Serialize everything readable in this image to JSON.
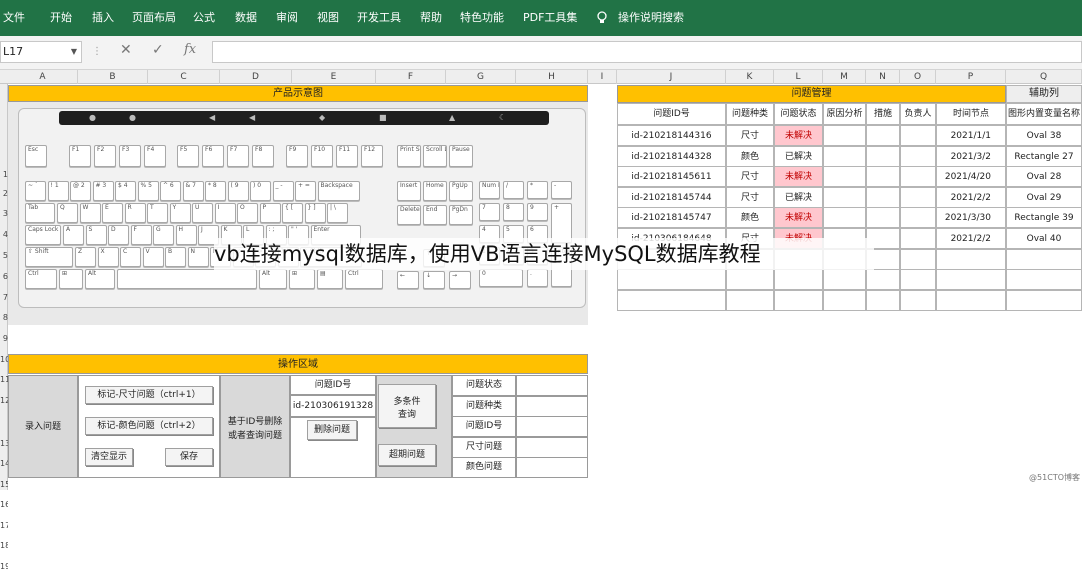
{
  "ribbon": {
    "menu": [
      "文件",
      "开始",
      "插入",
      "页面布局",
      "公式",
      "数据",
      "审阅",
      "视图",
      "开发工具",
      "帮助",
      "特色功能",
      "PDF工具集"
    ],
    "search_label": "操作说明搜索",
    "color": "#217346"
  },
  "formula_bar": {
    "name_box": "L17",
    "cancel_icon": "✕",
    "enter_icon": "✓",
    "function_icon": "fx",
    "value": ""
  },
  "columns": [
    "A",
    "B",
    "C",
    "D",
    "E",
    "F",
    "G",
    "H",
    "I",
    "J",
    "K",
    "L",
    "M",
    "N",
    "O",
    "P",
    "Q"
  ],
  "rows": [
    "1",
    "2",
    "3",
    "4",
    "5",
    "6",
    "7",
    "8",
    "9",
    "10",
    "11",
    "12",
    "13",
    "14",
    "15",
    "16",
    "17",
    "18",
    "19"
  ],
  "product_panel": {
    "title": "产品示意图"
  },
  "keyboard": {
    "fkeys": [
      "Esc",
      "F1",
      "F2",
      "F3",
      "F4",
      "F5",
      "F6",
      "F7",
      "F8",
      "F9",
      "F10",
      "F11",
      "F12"
    ],
    "nav_top": [
      "Print Screen SysRq",
      "Scroll Lock",
      "Pause Break"
    ],
    "nav_mid": [
      "Insert",
      "Home",
      "PgUp",
      "Delete",
      "End",
      "PgDn"
    ],
    "num_row": [
      "~ `",
      "! 1",
      "@ 2",
      "# 3",
      "$ 4",
      "% 5",
      "^ 6",
      "& 7",
      "* 8",
      "( 9",
      ") 0",
      "_ -",
      "+ =",
      "Backspace"
    ],
    "tab_row": [
      "Tab",
      "Q",
      "W",
      "E",
      "R",
      "T",
      "Y",
      "U",
      "I",
      "O",
      "P",
      "{ [",
      "} ]",
      "| \\"
    ],
    "caps_row": [
      "Caps Lock",
      "A",
      "S",
      "D",
      "F",
      "G",
      "H",
      "J",
      "K",
      "L",
      ": ;",
      "\" '",
      "Enter"
    ],
    "shift_row": [
      "⇧ Shift",
      "Z",
      "X",
      "C",
      "V",
      "B",
      "N",
      "M",
      "< ,",
      "> .",
      "? /",
      "⇧ Shift"
    ],
    "ctrl_row": [
      "Ctrl",
      "⊞",
      "Alt",
      "",
      "Alt",
      "⊞",
      "▤",
      "Ctrl"
    ],
    "arrows": [
      "↑",
      "←",
      "↓",
      "→"
    ],
    "numpad": [
      "Num Lock",
      "/",
      "*",
      "-",
      "7",
      "8",
      "9",
      "+",
      "4",
      "5",
      "6",
      "1",
      "2",
      "3",
      "Enter",
      "0",
      "."
    ]
  },
  "ops_panel": {
    "title": "操作区域",
    "entry_label": "录入问题",
    "btn_mark_size": "标记-尺寸问题（ctrl+1）",
    "btn_mark_color": "标记-颜色问题（ctrl+2）",
    "btn_clear": "清空显示",
    "btn_save": "保存",
    "delete_label_1": "基于ID号删除",
    "delete_label_2": "或者查询问题",
    "id_header": "问题ID号",
    "id_value": "id-210306191328",
    "btn_delete": "删除问题",
    "btn_multi_1": "多条件",
    "btn_multi_2": "查询",
    "btn_overdue": "超期问题",
    "query_fields": [
      "问题状态",
      "问题种类",
      "问题ID号",
      "尺寸问题",
      "颜色问题"
    ]
  },
  "issue_table": {
    "title": "问题管理",
    "aux_title": "辅助列",
    "headers": [
      "问题ID号",
      "问题种类",
      "问题状态",
      "原因分析",
      "措施",
      "负责人",
      "时间节点",
      "图形内置变量名称"
    ],
    "rows": [
      {
        "id": "id-210218144316",
        "type": "尺寸",
        "status": "未解决",
        "date": "2021/1/1",
        "shape": "Oval 38"
      },
      {
        "id": "id-210218144328",
        "type": "颜色",
        "status": "已解决",
        "date": "2021/3/2",
        "shape": "Rectangle 27"
      },
      {
        "id": "id-210218145611",
        "type": "尺寸",
        "status": "未解决",
        "date": "2021/4/20",
        "shape": "Oval 28"
      },
      {
        "id": "id-210218145744",
        "type": "尺寸",
        "status": "已解决",
        "date": "2021/2/2",
        "shape": "Oval 29"
      },
      {
        "id": "id-210218145747",
        "type": "颜色",
        "status": "未解决",
        "date": "2021/3/30",
        "shape": "Rectangle 39"
      },
      {
        "id": "id-210306184648",
        "type": "尺寸",
        "status": "未解决",
        "date": "2021/2/2",
        "shape": "Oval 40"
      }
    ],
    "unsolved_bg": "#ffc7ce",
    "unsolved_fg": "#c00000"
  },
  "watermark": "vb连接mysql数据库，使用VB语言连接MySQL数据库教程",
  "corner_mark": "@51CTO博客"
}
